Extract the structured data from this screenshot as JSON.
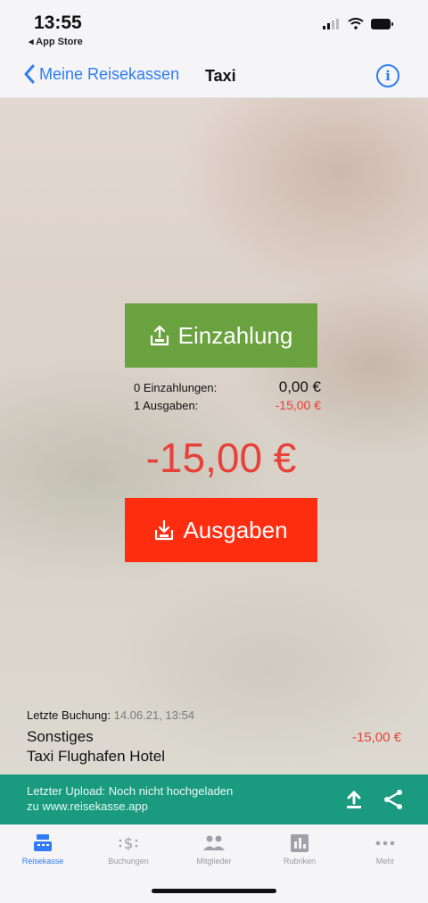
{
  "status": {
    "time": "13:55",
    "back_app": "◂ App Store"
  },
  "nav": {
    "back_label": "Meine Reisekassen",
    "title": "Taxi",
    "info": "i"
  },
  "main": {
    "deposit_button": "Einzahlung",
    "deposits_label": "0 Einzahlungen:",
    "deposits_value": "0,00 €",
    "expenses_label": "1 Ausgaben:",
    "expenses_value": "-15,00 €",
    "total": "-15,00 €",
    "expense_button": "Ausgaben"
  },
  "last_booking": {
    "label": "Letzte Buchung:",
    "date": "14.06.21, 13:54",
    "category": "Sonstiges",
    "description": "Taxi Flughafen Hotel",
    "amount": "-15,00 €"
  },
  "upload": {
    "line1": "Letzter Upload: Noch nicht hochgeladen",
    "line2": "zu www.reisekasse.app"
  },
  "tabs": [
    {
      "label": "Reisekasse",
      "icon": "cashbox-icon",
      "active": true
    },
    {
      "label": "Buchungen",
      "icon": "dollar-icon",
      "active": false
    },
    {
      "label": "Mitglieder",
      "icon": "people-icon",
      "active": false
    },
    {
      "label": "Rubriken",
      "icon": "chart-icon",
      "active": false
    },
    {
      "label": "Mehr",
      "icon": "more-icon",
      "active": false
    }
  ],
  "colors": {
    "accent": "#2f7cf6",
    "deposit_green": "#6aa23f",
    "expense_red": "#ff2d10",
    "negative_text": "#e8413a",
    "upload_bar": "#1a9a7f"
  }
}
